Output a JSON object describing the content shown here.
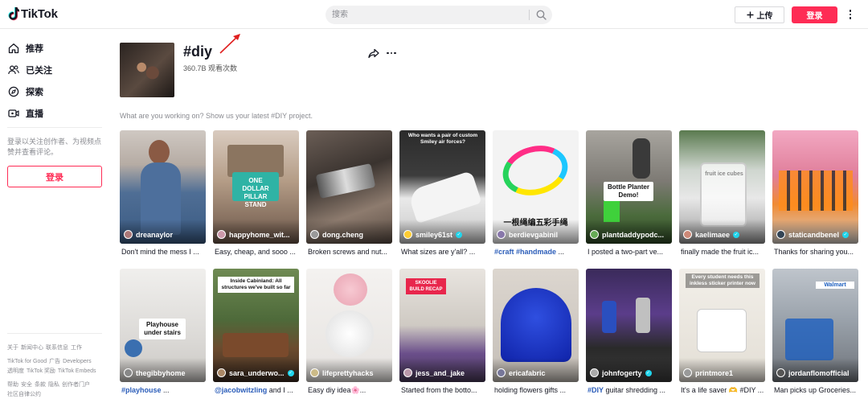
{
  "header": {
    "logo_text": "TikTok",
    "search_placeholder": "搜索",
    "upload_label": "上传",
    "login_label": "登录"
  },
  "sidebar": {
    "items": [
      {
        "label": "推荐",
        "icon": "home-icon"
      },
      {
        "label": "已关注",
        "icon": "following-icon"
      },
      {
        "label": "探索",
        "icon": "explore-icon"
      },
      {
        "label": "直播",
        "icon": "live-icon"
      }
    ],
    "login_hint": "登录以关注创作者、为视频点赞并查看评论。",
    "login_button": "登录",
    "footer": {
      "row1": [
        "关于",
        "新闻中心",
        "联系信息",
        "工作"
      ],
      "row2": [
        "TikTok for Good",
        "广告",
        "Developers"
      ],
      "row3": [
        "透明度",
        "TikTok 奖励",
        "TikTok Embeds"
      ],
      "row4": [
        "帮助",
        "安全",
        "条款",
        "隐私",
        "创作者门户"
      ],
      "row5": [
        "社区自律公约"
      ]
    }
  },
  "tag": {
    "title": "#diy",
    "views": "360.7B 观看次数",
    "description": "What are you working on? Show us your latest #DIY project."
  },
  "videos": [
    {
      "author": "dreanaylor",
      "verified": false,
      "caption_tag": "",
      "caption": "Don't mind the mess I ...",
      "overlay": ""
    },
    {
      "author": "happyhome_wit...",
      "verified": false,
      "caption_tag": "",
      "caption": "Easy, cheap, and sooo ...",
      "overlay": "ONE DOLLAR PILLAR STAND"
    },
    {
      "author": "dong.cheng",
      "verified": false,
      "caption_tag": "",
      "caption": "Broken screws and nut...",
      "overlay": ""
    },
    {
      "author": "smiley61st",
      "verified": true,
      "caption_tag": "",
      "caption": "What sizes are y'all? ...",
      "overlay": "Who wants a pair of custom Smiley air forces?"
    },
    {
      "author": "berdievgabinil",
      "verified": false,
      "caption_tag": "#craft #handmade",
      "caption": " ...",
      "overlay": "一根绳编五彩手绳"
    },
    {
      "author": "plantdaddypodc...",
      "verified": false,
      "caption_tag": "",
      "caption": "I posted a two-part ve...",
      "overlay": "Bottle Planter Demo!"
    },
    {
      "author": "kaelimaee",
      "verified": true,
      "caption_tag": "",
      "caption": "finally made the fruit ic...",
      "overlay": "fruit ice cubes"
    },
    {
      "author": "staticandbenel",
      "verified": true,
      "caption_tag": "",
      "caption": "Thanks for sharing you...",
      "overlay": ""
    },
    {
      "author": "thegibbyhome",
      "verified": false,
      "caption_tag": "#playhouse",
      "caption": " ...",
      "overlay": "Playhouse under stairs"
    },
    {
      "author": "sara_underwo...",
      "verified": true,
      "caption_tag": "@jacobwitzling",
      "caption": " and I ...",
      "overlay": "Inside Cabinland: All structures we've built so far"
    },
    {
      "author": "lifeprettyhacks",
      "verified": false,
      "caption_tag": "",
      "caption": "Easy diy idea🌸...",
      "overlay": ""
    },
    {
      "author": "jess_and_jake",
      "verified": false,
      "caption_tag": "",
      "caption": "Started from the botto...",
      "overlay": "SKOOLIE BUILD RECAP"
    },
    {
      "author": "ericafabric",
      "verified": false,
      "caption_tag": "",
      "caption": "holding flowers gifts ...",
      "overlay": ""
    },
    {
      "author": "johnfogerty",
      "verified": true,
      "caption_tag": "#DIY",
      "caption": " guitar shredding ...",
      "overlay": ""
    },
    {
      "author": "printmore1",
      "verified": false,
      "caption_tag": "",
      "caption": "It's a life saver 🫶 #DIY ...",
      "overlay": "Every student needs this inkless sticker printer now"
    },
    {
      "author": "jordanflomofficial",
      "verified": false,
      "caption_tag": "",
      "caption": "Man picks up Groceries...",
      "overlay": "Walmart"
    }
  ]
}
